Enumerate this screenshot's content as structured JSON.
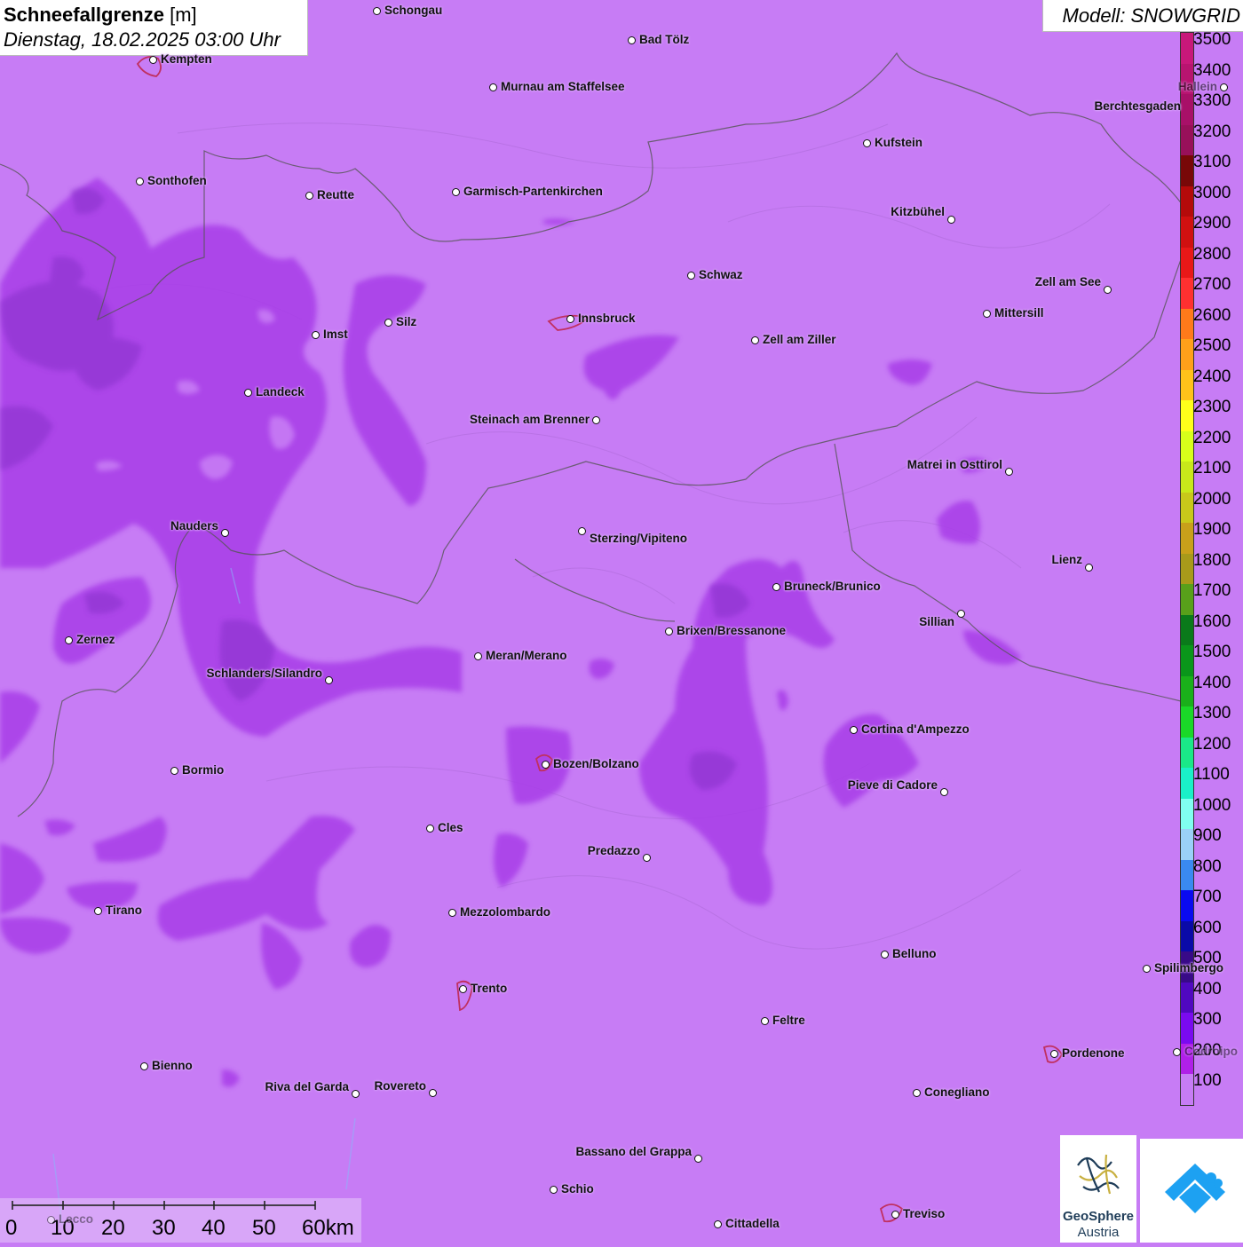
{
  "header": {
    "title_bold": "Schneefallgrenze",
    "title_unit": "[m]",
    "datetime": "Dienstag, 18.02.2025 03:00 Uhr"
  },
  "model": {
    "label": "Modell: SNOWGRID"
  },
  "legend": {
    "labels": [
      "3500",
      "3400",
      "3300",
      "3200",
      "3100",
      "3000",
      "2900",
      "2800",
      "2700",
      "2600",
      "2500",
      "2400",
      "2300",
      "2200",
      "2100",
      "2000",
      "1900",
      "1800",
      "1700",
      "1600",
      "1500",
      "1400",
      "1300",
      "1200",
      "1100",
      "1000",
      "900",
      "800",
      "700",
      "600",
      "500",
      "400",
      "300",
      "200",
      "100"
    ],
    "colors": [
      "#c8187a",
      "#b81470",
      "#a81068",
      "#98105a",
      "#780808",
      "#b40a0a",
      "#d01010",
      "#e81818",
      "#ff3030",
      "#ff7a1a",
      "#ffa01a",
      "#ffc21a",
      "#ffff1a",
      "#d8ff1a",
      "#c8e81a",
      "#c8c81a",
      "#c8a01a",
      "#a89a1a",
      "#58a01a",
      "#0a7a1a",
      "#0a961a",
      "#1ab01a",
      "#1ad828",
      "#1ae888",
      "#1af0c8",
      "#80fff0",
      "#9ad0f8",
      "#3a8af0",
      "#0a0af0",
      "#0a0aa8",
      "#380a88",
      "#5008c0",
      "#7a0af0",
      "#b020e8",
      "#c77cf5"
    ]
  },
  "cities": [
    {
      "name": "Schongau"
    },
    {
      "name": "Bad Tölz"
    },
    {
      "name": "Kempten"
    },
    {
      "name": "Murnau am Staffelsee"
    },
    {
      "name": "Hallein"
    },
    {
      "name": "Berchtesgaden"
    },
    {
      "name": "Kufstein"
    },
    {
      "name": "Sonthofen"
    },
    {
      "name": "Reutte"
    },
    {
      "name": "Garmisch-Partenkirchen"
    },
    {
      "name": "Kitzbühel"
    },
    {
      "name": "Schwaz"
    },
    {
      "name": "Zell am See"
    },
    {
      "name": "Mittersill"
    },
    {
      "name": "Innsbruck"
    },
    {
      "name": "Silz"
    },
    {
      "name": "Imst"
    },
    {
      "name": "Zell am Ziller"
    },
    {
      "name": "Landeck"
    },
    {
      "name": "Steinach am Brenner"
    },
    {
      "name": "Matrei in Osttirol"
    },
    {
      "name": "Nauders"
    },
    {
      "name": "Sterzing/Vipiteno"
    },
    {
      "name": "Lienz"
    },
    {
      "name": "Bruneck/Brunico"
    },
    {
      "name": "Sillian"
    },
    {
      "name": "Brixen/Bressanone"
    },
    {
      "name": "Zernez"
    },
    {
      "name": "Meran/Merano"
    },
    {
      "name": "Schlanders/Silandro"
    },
    {
      "name": "Cortina d'Ampezzo"
    },
    {
      "name": "Bozen/Bolzano"
    },
    {
      "name": "Bormio"
    },
    {
      "name": "Pieve di Cadore"
    },
    {
      "name": "Cles"
    },
    {
      "name": "Predazzo"
    },
    {
      "name": "Tirano"
    },
    {
      "name": "Mezzolombardo"
    },
    {
      "name": "Belluno"
    },
    {
      "name": "Spilimbergo"
    },
    {
      "name": "Trento"
    },
    {
      "name": "Feltre"
    },
    {
      "name": "Pordenone"
    },
    {
      "name": "Codroipo"
    },
    {
      "name": "Bienno"
    },
    {
      "name": "Riva del Garda"
    },
    {
      "name": "Rovereto"
    },
    {
      "name": "Conegliano"
    },
    {
      "name": "Bassano del Grappa"
    },
    {
      "name": "Schio"
    },
    {
      "name": "Lecco"
    },
    {
      "name": "Treviso"
    },
    {
      "name": "Cittadella"
    }
  ],
  "scale": {
    "labels": [
      "0",
      "10",
      "20",
      "30",
      "40",
      "50",
      "60km"
    ]
  },
  "logos": {
    "geosphere_name": "GeoSphere",
    "geosphere_sub": "Austria"
  }
}
